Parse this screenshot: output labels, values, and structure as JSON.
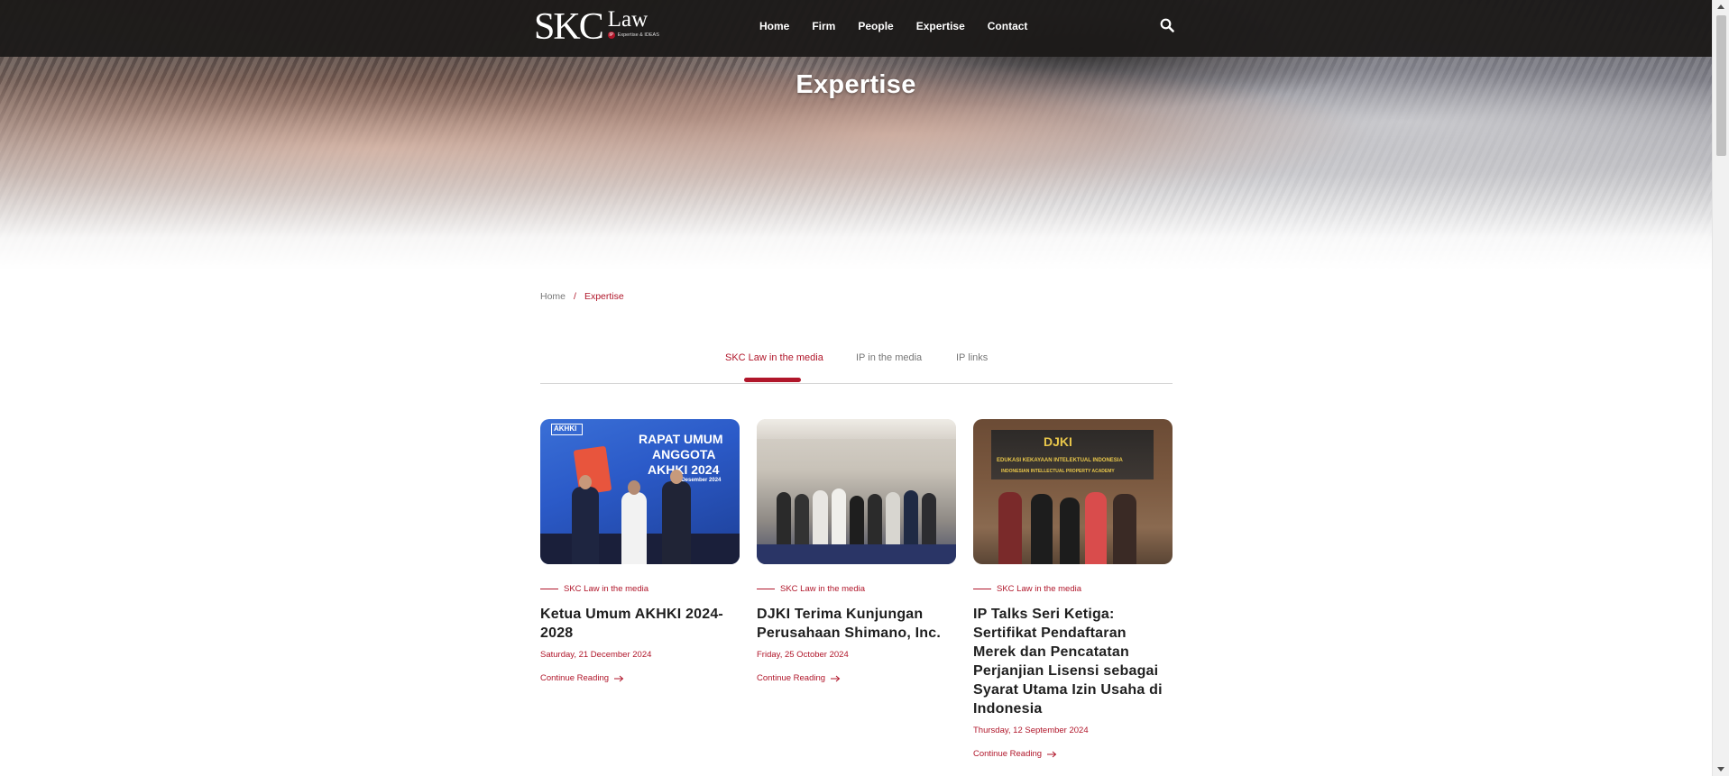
{
  "brand": {
    "name": "SKC",
    "suffix": "Law",
    "badge": "IP",
    "tagline": "Expertise & IDEAS"
  },
  "nav": {
    "items": [
      "Home",
      "Firm",
      "People",
      "Expertise",
      "Contact"
    ],
    "search_icon": "search-icon"
  },
  "hero": {
    "title": "Expertise"
  },
  "breadcrumb": {
    "home": "Home",
    "separator": "/",
    "current": "Expertise"
  },
  "tabs": [
    {
      "label": "SKC Law in the media",
      "active": true
    },
    {
      "label": "IP in the media",
      "active": false
    },
    {
      "label": "IP links",
      "active": false
    }
  ],
  "articles": [
    {
      "category": "SKC Law in the media",
      "title": "Ketua Umum AKHKI 2024-2028",
      "date": "Saturday, 21 December 2024",
      "link": "Continue Reading",
      "image": {
        "logo": "AKHKI",
        "line1": "RAPAT UMUM",
        "line2": "ANGGOTA",
        "line3": "AKHKI 2024",
        "line4": "19 Desember 2024"
      }
    },
    {
      "category": "SKC Law in the media",
      "title": "DJKI Terima Kunjungan Perusahaan Shimano, Inc.",
      "date": "Friday, 25 October 2024",
      "link": "Continue Reading"
    },
    {
      "category": "SKC Law in the media",
      "title": "IP Talks Seri Ketiga: Sertifikat Pendaftaran Merek dan Pencatatan Perjanjian Lisensi sebagai Syarat Utama Izin Usaha di Indonesia",
      "date": "Thursday, 12 September 2024",
      "link": "Continue Reading",
      "image": {
        "logo": "DJKI",
        "line1": "EDUKASI KEKAYAAN INTELEKTUAL INDONESIA",
        "line2": "INDONESIAN INTELLECTUAL PROPERTY ACADEMY"
      }
    }
  ],
  "colors": {
    "accent": "#b0162a",
    "navbar": "#1c1a19"
  }
}
